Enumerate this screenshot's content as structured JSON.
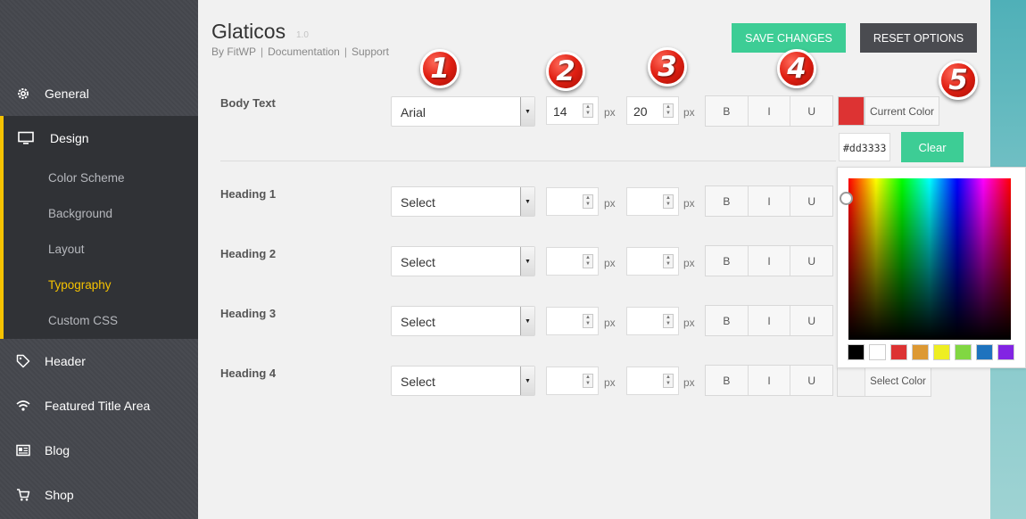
{
  "sidebar": {
    "items": [
      {
        "label": "General",
        "icon": "gear-icon"
      },
      {
        "label": "Design",
        "icon": "monitor-icon"
      },
      {
        "label": "Header",
        "icon": "tag-icon"
      },
      {
        "label": "Featured Title Area",
        "icon": "wifi-icon"
      },
      {
        "label": "Blog",
        "icon": "newspaper-icon"
      },
      {
        "label": "Shop",
        "icon": "cart-icon"
      }
    ],
    "design_sub": [
      {
        "label": "Color Scheme"
      },
      {
        "label": "Background"
      },
      {
        "label": "Layout"
      },
      {
        "label": "Typography"
      },
      {
        "label": "Custom CSS"
      }
    ],
    "accent_color": "#f5c200"
  },
  "header": {
    "title": "Glaticos",
    "version": "1.0",
    "by": "By FitWP",
    "link_documentation": "Documentation",
    "link_support": "Support",
    "sep": "|",
    "save_label": "SAVE CHANGES",
    "reset_label": "RESET OPTIONS"
  },
  "typography": {
    "unit": "px",
    "rows": [
      {
        "label": "Body Text",
        "font": "Arial",
        "size": "14",
        "line_height": "20"
      },
      {
        "label": "Heading 1",
        "font": "Select",
        "size": "",
        "line_height": ""
      },
      {
        "label": "Heading 2",
        "font": "Select",
        "size": "",
        "line_height": ""
      },
      {
        "label": "Heading 3",
        "font": "Select",
        "size": "",
        "line_height": ""
      },
      {
        "label": "Heading 4",
        "font": "Select",
        "size": "",
        "line_height": ""
      }
    ],
    "style_buttons": {
      "bold": "B",
      "italic": "I",
      "underline": "U"
    },
    "current_color_label": "Current Color",
    "select_color_label": "Select Color",
    "hex_value": "#dd3333",
    "clear_label": "Clear",
    "swatch_color": "#dd3333",
    "palette": [
      "#000000",
      "#ffffff",
      "#dd3333",
      "#dd9933",
      "#eeee22",
      "#81d742",
      "#1e73be",
      "#8224e3"
    ]
  },
  "callouts": [
    "1",
    "2",
    "3",
    "4",
    "5"
  ]
}
